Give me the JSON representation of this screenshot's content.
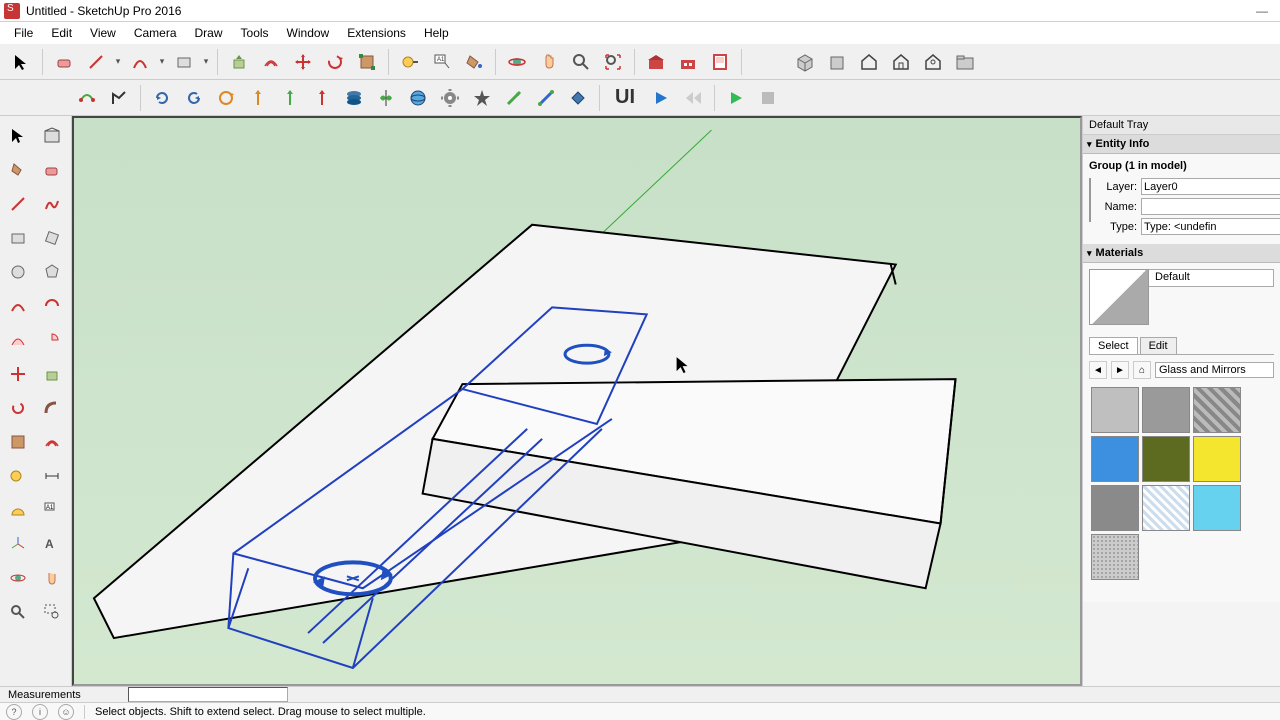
{
  "title": "Untitled - SketchUp Pro 2016",
  "menubar": [
    "File",
    "Edit",
    "View",
    "Camera",
    "Draw",
    "Tools",
    "Window",
    "Extensions",
    "Help"
  ],
  "tray": {
    "title": "Default Tray",
    "entity": {
      "header": "Entity Info",
      "group_label": "Group (1 in model)",
      "layer_label": "Layer:",
      "layer_value": "Layer0",
      "name_label": "Name:",
      "name_value": "",
      "type_label": "Type:",
      "type_value": "Type: <undefin"
    },
    "materials": {
      "header": "Materials",
      "current": "Default",
      "tabs": {
        "select": "Select",
        "edit": "Edit"
      },
      "category": "Glass and Mirrors",
      "swatches": [
        {
          "name": "gray-glass",
          "bg": "#bfbfbf"
        },
        {
          "name": "dark-glass",
          "bg": "#9a9a9a"
        },
        {
          "name": "mirror-tile",
          "bg": "#b5b5b5",
          "pattern": "tile"
        },
        {
          "name": "blue-glass",
          "bg": "#3d8fe0"
        },
        {
          "name": "olive",
          "bg": "#5c6b1f"
        },
        {
          "name": "yellow",
          "bg": "#f4e62e"
        },
        {
          "name": "medium-gray",
          "bg": "#8a8a8a"
        },
        {
          "name": "clear-hatch",
          "bg": "#eaf6ff",
          "pattern": "hatch"
        },
        {
          "name": "cyan",
          "bg": "#67d1f0"
        },
        {
          "name": "noise",
          "bg": "#c4c4c4",
          "pattern": "noise"
        }
      ]
    }
  },
  "measurements_label": "Measurements",
  "status_hint": "Select objects. Shift to extend select. Drag mouse to select multiple.",
  "chart_data": {
    "type": "table",
    "note": "not a chart"
  }
}
